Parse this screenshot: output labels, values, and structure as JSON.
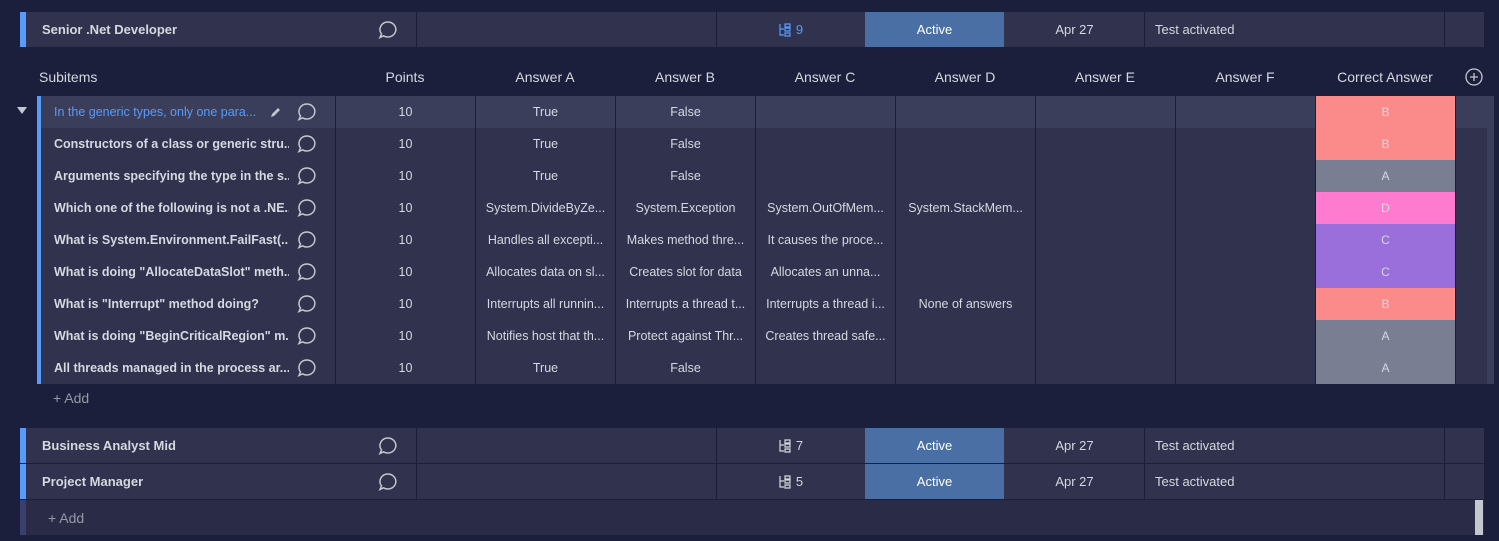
{
  "items": [
    {
      "name": "Senior .Net Developer",
      "subitems_count": "9",
      "status": "Active",
      "date": "Apr 27",
      "text": "Test activated"
    },
    {
      "name": "Business Analyst Mid",
      "subitems_count": "7",
      "status": "Active",
      "date": "Apr 27",
      "text": "Test activated"
    },
    {
      "name": "Project Manager",
      "subitems_count": "5",
      "status": "Active",
      "date": "Apr 27",
      "text": "Test activated"
    }
  ],
  "subitems_header": {
    "title": "Subitems",
    "points": "Points",
    "answer_a": "Answer A",
    "answer_b": "Answer B",
    "answer_c": "Answer C",
    "answer_d": "Answer D",
    "answer_e": "Answer E",
    "answer_f": "Answer F",
    "correct": "Correct Answer"
  },
  "subitems": [
    {
      "name": "In the generic types, only one para...",
      "points": "10",
      "a": "True",
      "b": "False",
      "c": "",
      "d": "",
      "e": "",
      "f": "",
      "correct": "B",
      "color": "#fb8b8b"
    },
    {
      "name": "Constructors of a class or generic stru...",
      "points": "10",
      "a": "True",
      "b": "False",
      "c": "",
      "d": "",
      "e": "",
      "f": "",
      "correct": "B",
      "color": "#fb8b8b"
    },
    {
      "name": "Arguments specifying the type in the s...",
      "points": "10",
      "a": "True",
      "b": "False",
      "c": "",
      "d": "",
      "e": "",
      "f": "",
      "correct": "A",
      "color": "#797e93"
    },
    {
      "name": "Which one of the following is not a .NE...",
      "points": "10",
      "a": "System.DivideByZe...",
      "b": "System.Exception",
      "c": "System.OutOfMem...",
      "d": "System.StackMem...",
      "e": "",
      "f": "",
      "correct": "D",
      "color": "#ff7bd0"
    },
    {
      "name": "What is System.Environment.FailFast(...",
      "points": "10",
      "a": "Handles all excepti...",
      "b": "Makes method thre...",
      "c": "It causes the proce...",
      "d": "",
      "e": "",
      "f": "",
      "correct": "C",
      "color": "#9b6fdb"
    },
    {
      "name": "What is doing \"AllocateDataSlot\" meth...",
      "points": "10",
      "a": "Allocates data on sl...",
      "b": "Creates slot for data",
      "c": "Allocates an unna...",
      "d": "",
      "e": "",
      "f": "",
      "correct": "C",
      "color": "#9b6fdb"
    },
    {
      "name": "What is \"Interrupt\" method doing?",
      "points": "10",
      "a": "Interrupts all runnin...",
      "b": "Interrupts a thread t...",
      "c": "Interrupts a thread i...",
      "d": "None of answers",
      "e": "",
      "f": "",
      "correct": "B",
      "color": "#fb8b8b"
    },
    {
      "name": "What is doing \"BeginCriticalRegion\" m...",
      "points": "10",
      "a": "Notifies host that th...",
      "b": "Protect against Thr...",
      "c": "Creates thread safe...",
      "d": "",
      "e": "",
      "f": "",
      "correct": "A",
      "color": "#797e93"
    },
    {
      "name": "All threads managed in the process ar...",
      "points": "10",
      "a": "True",
      "b": "False",
      "c": "",
      "d": "",
      "e": "",
      "f": "",
      "correct": "A",
      "color": "#797e93"
    }
  ],
  "add_subitem_label": "+ Add",
  "add_item_label": "+ Add",
  "colors": {
    "accent": "#579bfc",
    "status_active": "#4a6fa5",
    "background": "#1c1f3b",
    "row": "#30324e"
  }
}
